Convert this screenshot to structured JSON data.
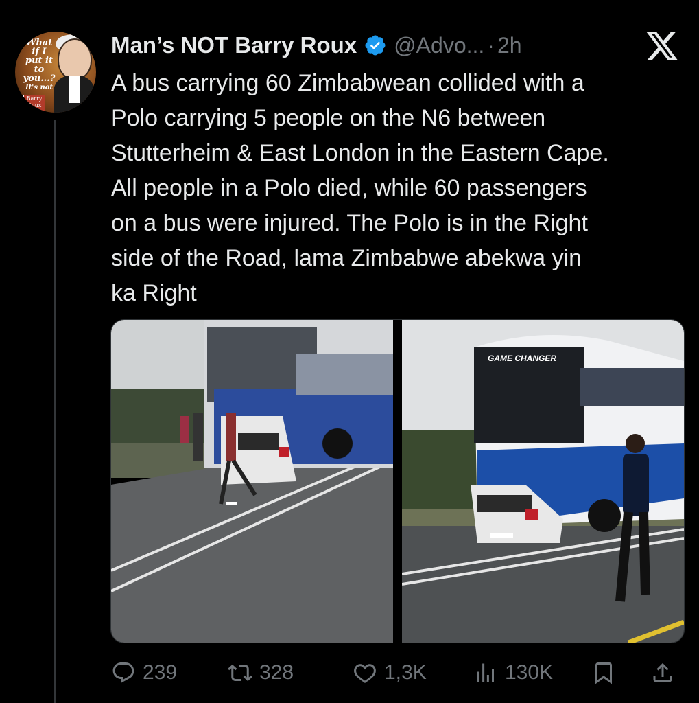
{
  "author": {
    "name": "Man’s NOT Barry Roux",
    "handle": "@Advo...",
    "separator": "·",
    "time": "2h",
    "avatar_text": [
      "What",
      "if I",
      "put it",
      "to you...?",
      "It's not",
      "Barry",
      "Roux"
    ]
  },
  "tweet": {
    "lines": [
      "A bus carrying 60 Zimbabwean collided with a",
      "Polo carrying 5 people on the N6 between",
      "Stutterheim & East London in the Eastern Cape.",
      "All people in a Polo died, while 60 passengers",
      "on a bus were injured. The Polo is in the Right",
      "side of the Road, lama Zimbabwe abekwa yin",
      "ka Right"
    ]
  },
  "media": {
    "photo2_bus_label": "GAME CHANGER"
  },
  "actions": {
    "replies": "239",
    "retweets": "328",
    "likes": "1,3K",
    "views": "130K"
  },
  "icons": {
    "verified": "verified-badge-icon",
    "platform": "x-logo-icon",
    "reply": "reply-icon",
    "retweet": "retweet-icon",
    "like": "heart-icon",
    "views": "views-icon",
    "bookmark": "bookmark-icon",
    "share": "share-icon"
  },
  "colors": {
    "background": "#000000",
    "text": "#e7e9ea",
    "muted": "#71767b",
    "verified": "#1d9bf0"
  }
}
